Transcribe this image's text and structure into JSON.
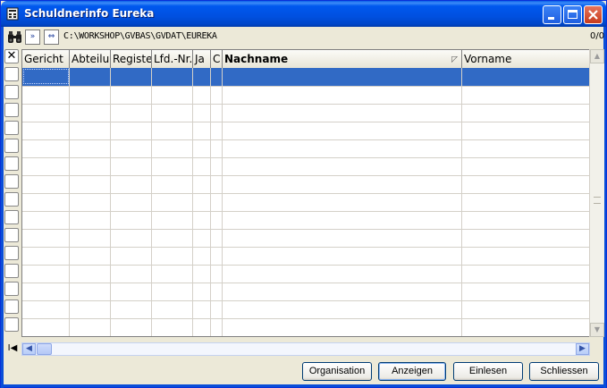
{
  "window": {
    "title": "Schuldnerinfo Eureka",
    "minimize_label": "",
    "maximize_label": "",
    "close_label": ""
  },
  "toolbar": {
    "forward_label": "»",
    "swap_label": "⇔",
    "path": "C:\\WORKSHOP\\GVBAS\\GVDAT\\EUREKA",
    "record_counter": "0/0"
  },
  "grid": {
    "delete_marker": "✕",
    "first_record_label": "I◀",
    "columns": [
      {
        "label": "Gericht",
        "bold": false
      },
      {
        "label": "Abteilung",
        "bold": false
      },
      {
        "label": "Registernummer",
        "bold": false
      },
      {
        "label": "Lfd.-Nr.",
        "bold": false
      },
      {
        "label": "Ja",
        "bold": false
      },
      {
        "label": "C",
        "bold": false
      },
      {
        "label": "Nachname",
        "bold": true,
        "sorted": true
      },
      {
        "label": "Vorname",
        "bold": false
      }
    ],
    "rows_visible": 15,
    "selected_row": 0
  },
  "buttons": {
    "organisation": "Organisation",
    "anzeigen": "Anzeigen",
    "einlesen": "Einlesen",
    "schliessen": "Schliessen"
  },
  "colors": {
    "titlebar": "#0054e3",
    "selection": "#316ac5",
    "window_bg": "#ece9d8"
  }
}
